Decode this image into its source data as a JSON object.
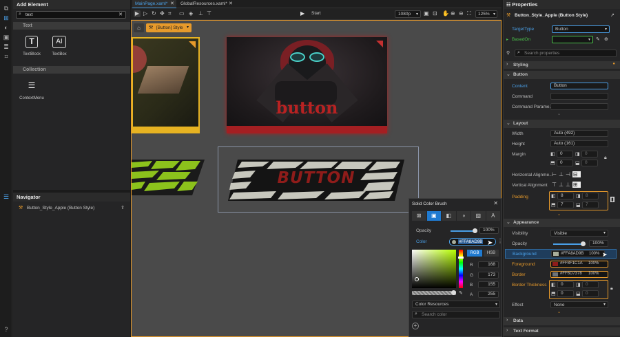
{
  "left_panel": {
    "title": "Add Element",
    "search_value": "text",
    "sections": [
      {
        "label": "Text",
        "items": [
          "TextBlock",
          "TextBox"
        ]
      },
      {
        "label": "Collection",
        "items": [
          "ContextMenu"
        ]
      }
    ]
  },
  "navigator": {
    "title": "Navigator",
    "item": "Button_Style_Apple (Button Style)"
  },
  "tabs": [
    "MainPage.xaml*",
    "GlobalResources.xaml*"
  ],
  "toolbar": {
    "start": "Start",
    "resolution": "1080p",
    "zoom": "125%"
  },
  "breadcrumb": "[Button] Style",
  "canvas": {
    "button_text_1": "button",
    "button_text_2": "BUTTON"
  },
  "color_popup": {
    "title": "Solid Color Brush",
    "opacity_label": "Opacity",
    "opacity_value": "100%",
    "color_label": "Color",
    "color_value": "#FFA8AD9B",
    "modes": [
      "RGB",
      "HSB"
    ],
    "r_label": "R",
    "r": "168",
    "g_label": "G",
    "g": "173",
    "b_label": "B",
    "b": "155",
    "a_label": "A",
    "a": "255",
    "resources": "Color Resources",
    "search_placeholder": "Search color"
  },
  "properties": {
    "title": "Properties",
    "element": "Button_Style_Apple (Button Style)",
    "target_type_label": "TargetType",
    "target_type": "Button",
    "based_on_label": "BasedOn",
    "search_placeholder": "Search properties",
    "styling": "Styling",
    "button_section": "Button",
    "content_label": "Content",
    "content": "Button",
    "command_label": "Command",
    "command_param_label": "Command Parame...",
    "layout": "Layout",
    "width_label": "Width",
    "width": "Auto (492)",
    "height_label": "Height",
    "height": "Auto (161)",
    "margin_label": "Margin",
    "margin": [
      "0",
      "0",
      "0",
      "0"
    ],
    "halign_label": "Horizontal Alignme...",
    "valign_label": "Vertical Alignment",
    "padding_label": "Padding",
    "padding": [
      "8",
      "8",
      "7",
      "7"
    ],
    "appearance": "Appearance",
    "visibility_label": "Visibility",
    "visibility": "Visible",
    "opacity_label": "Opacity",
    "opacity": "100%",
    "background_label": "Background",
    "background": "#FFA8AD9B",
    "background_pct": "100%",
    "background_color": "#a8ad9b",
    "foreground_label": "Foreground",
    "foreground": "#FF8F1C1A",
    "foreground_pct": "100%",
    "foreground_color": "#8f1c1a",
    "border_label": "Border",
    "border": "#FF6D7378",
    "border_pct": "100%",
    "border_color": "#6d7378",
    "border_thickness_label": "Border Thickness",
    "border_thickness": [
      "0",
      "0",
      "0",
      "0"
    ],
    "effect_label": "Effect",
    "effect": "None",
    "data": "Data",
    "text_format": "Text Format"
  }
}
